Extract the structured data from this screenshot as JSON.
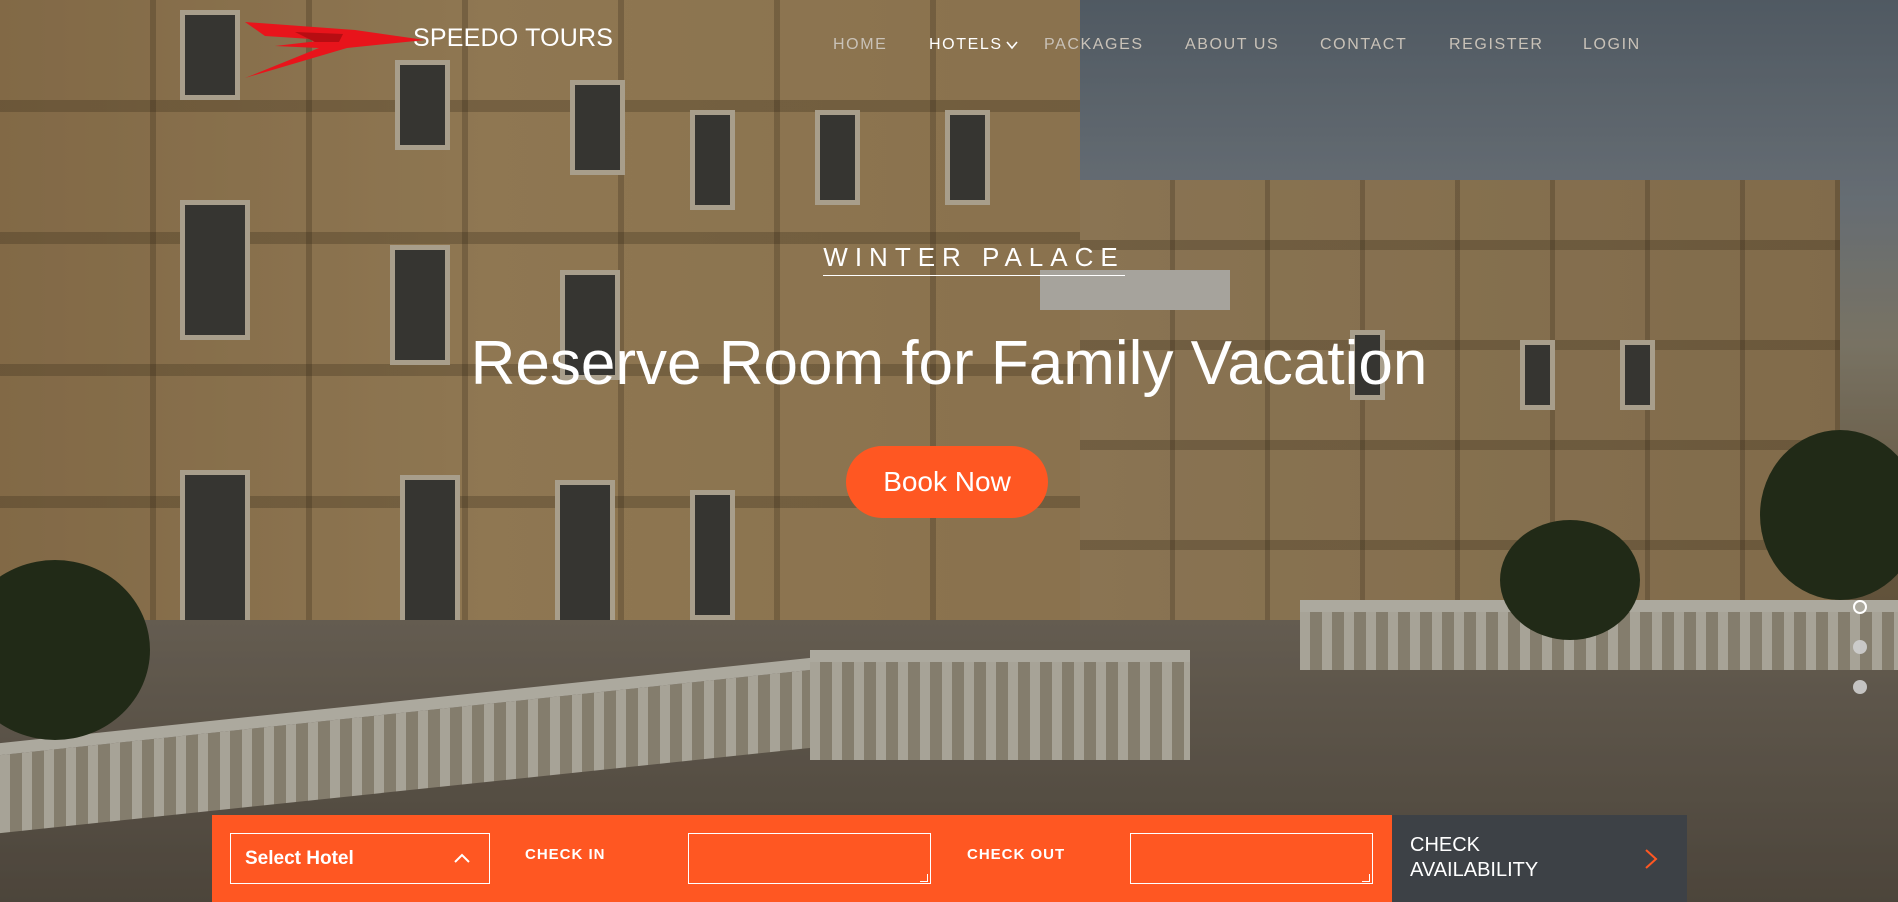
{
  "brand": {
    "name": "SPEEDO TOURS",
    "logo_color": "#e8141b"
  },
  "nav": {
    "items": [
      {
        "label": "HOME",
        "active": false
      },
      {
        "label": "HOTELS",
        "active": true,
        "has_dropdown": true
      },
      {
        "label": "PACKAGES",
        "active": false
      },
      {
        "label": "ABOUT US",
        "active": false
      },
      {
        "label": "CONTACT",
        "active": false
      },
      {
        "label": "REGISTER",
        "active": false
      },
      {
        "label": "LOGIN",
        "active": false
      }
    ]
  },
  "hero": {
    "kicker": "WINTER PALACE",
    "headline": "Reserve Room for Family Vacation",
    "cta_label": "Book Now",
    "slides": {
      "count": 3,
      "active_index": 0
    }
  },
  "booking": {
    "hotel_select": "Select Hotel",
    "check_in_label": "CHECK IN",
    "check_in_value": "",
    "check_out_label": "CHECK OUT",
    "check_out_value": "",
    "submit_line1": "CHECK",
    "submit_line2": "AVAILABILITY"
  },
  "colors": {
    "accent": "#ff5722",
    "dark_button": "#3d4146",
    "nav_inactive": "#c9c2b8",
    "nav_active": "#ffffff"
  },
  "icons": {
    "logo": "speedo-logo-icon",
    "nav_dropdown": "chevron-down-icon",
    "select_caret": "chevron-up-icon",
    "submit_arrow": "chevron-right-icon"
  }
}
